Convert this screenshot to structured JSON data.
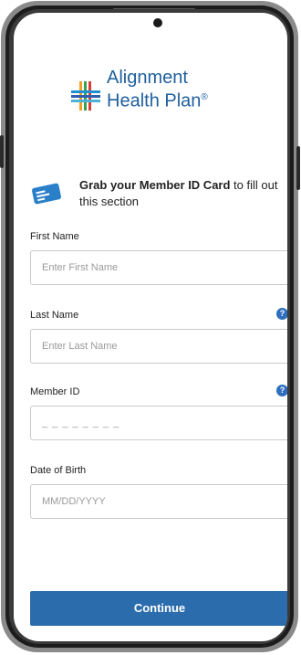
{
  "logo": {
    "line1": "Alignment",
    "line2": "Health Plan",
    "mark": "®"
  },
  "prompt": {
    "bold_part": "Grab your Member ID Card",
    "rest_part": " to fill out this section"
  },
  "fields": {
    "first_name": {
      "label": "First Name",
      "placeholder": "Enter First Name"
    },
    "last_name": {
      "label": "Last Name",
      "placeholder": "Enter Last Name"
    },
    "member_id": {
      "label": "Member ID",
      "placeholder": "_ _ _ _ _ _ _ _"
    },
    "dob": {
      "label": "Date of Birth",
      "placeholder": "MM/DD/YYYY"
    }
  },
  "help_glyph": "?",
  "buttons": {
    "continue": "Continue"
  },
  "colors": {
    "brand": "#1f5f9e",
    "button": "#2b6cad",
    "help": "#2e6ebf"
  },
  "icons": [
    "camera-icon",
    "logo-cross-icon",
    "member-card-icon",
    "help-icon"
  ]
}
